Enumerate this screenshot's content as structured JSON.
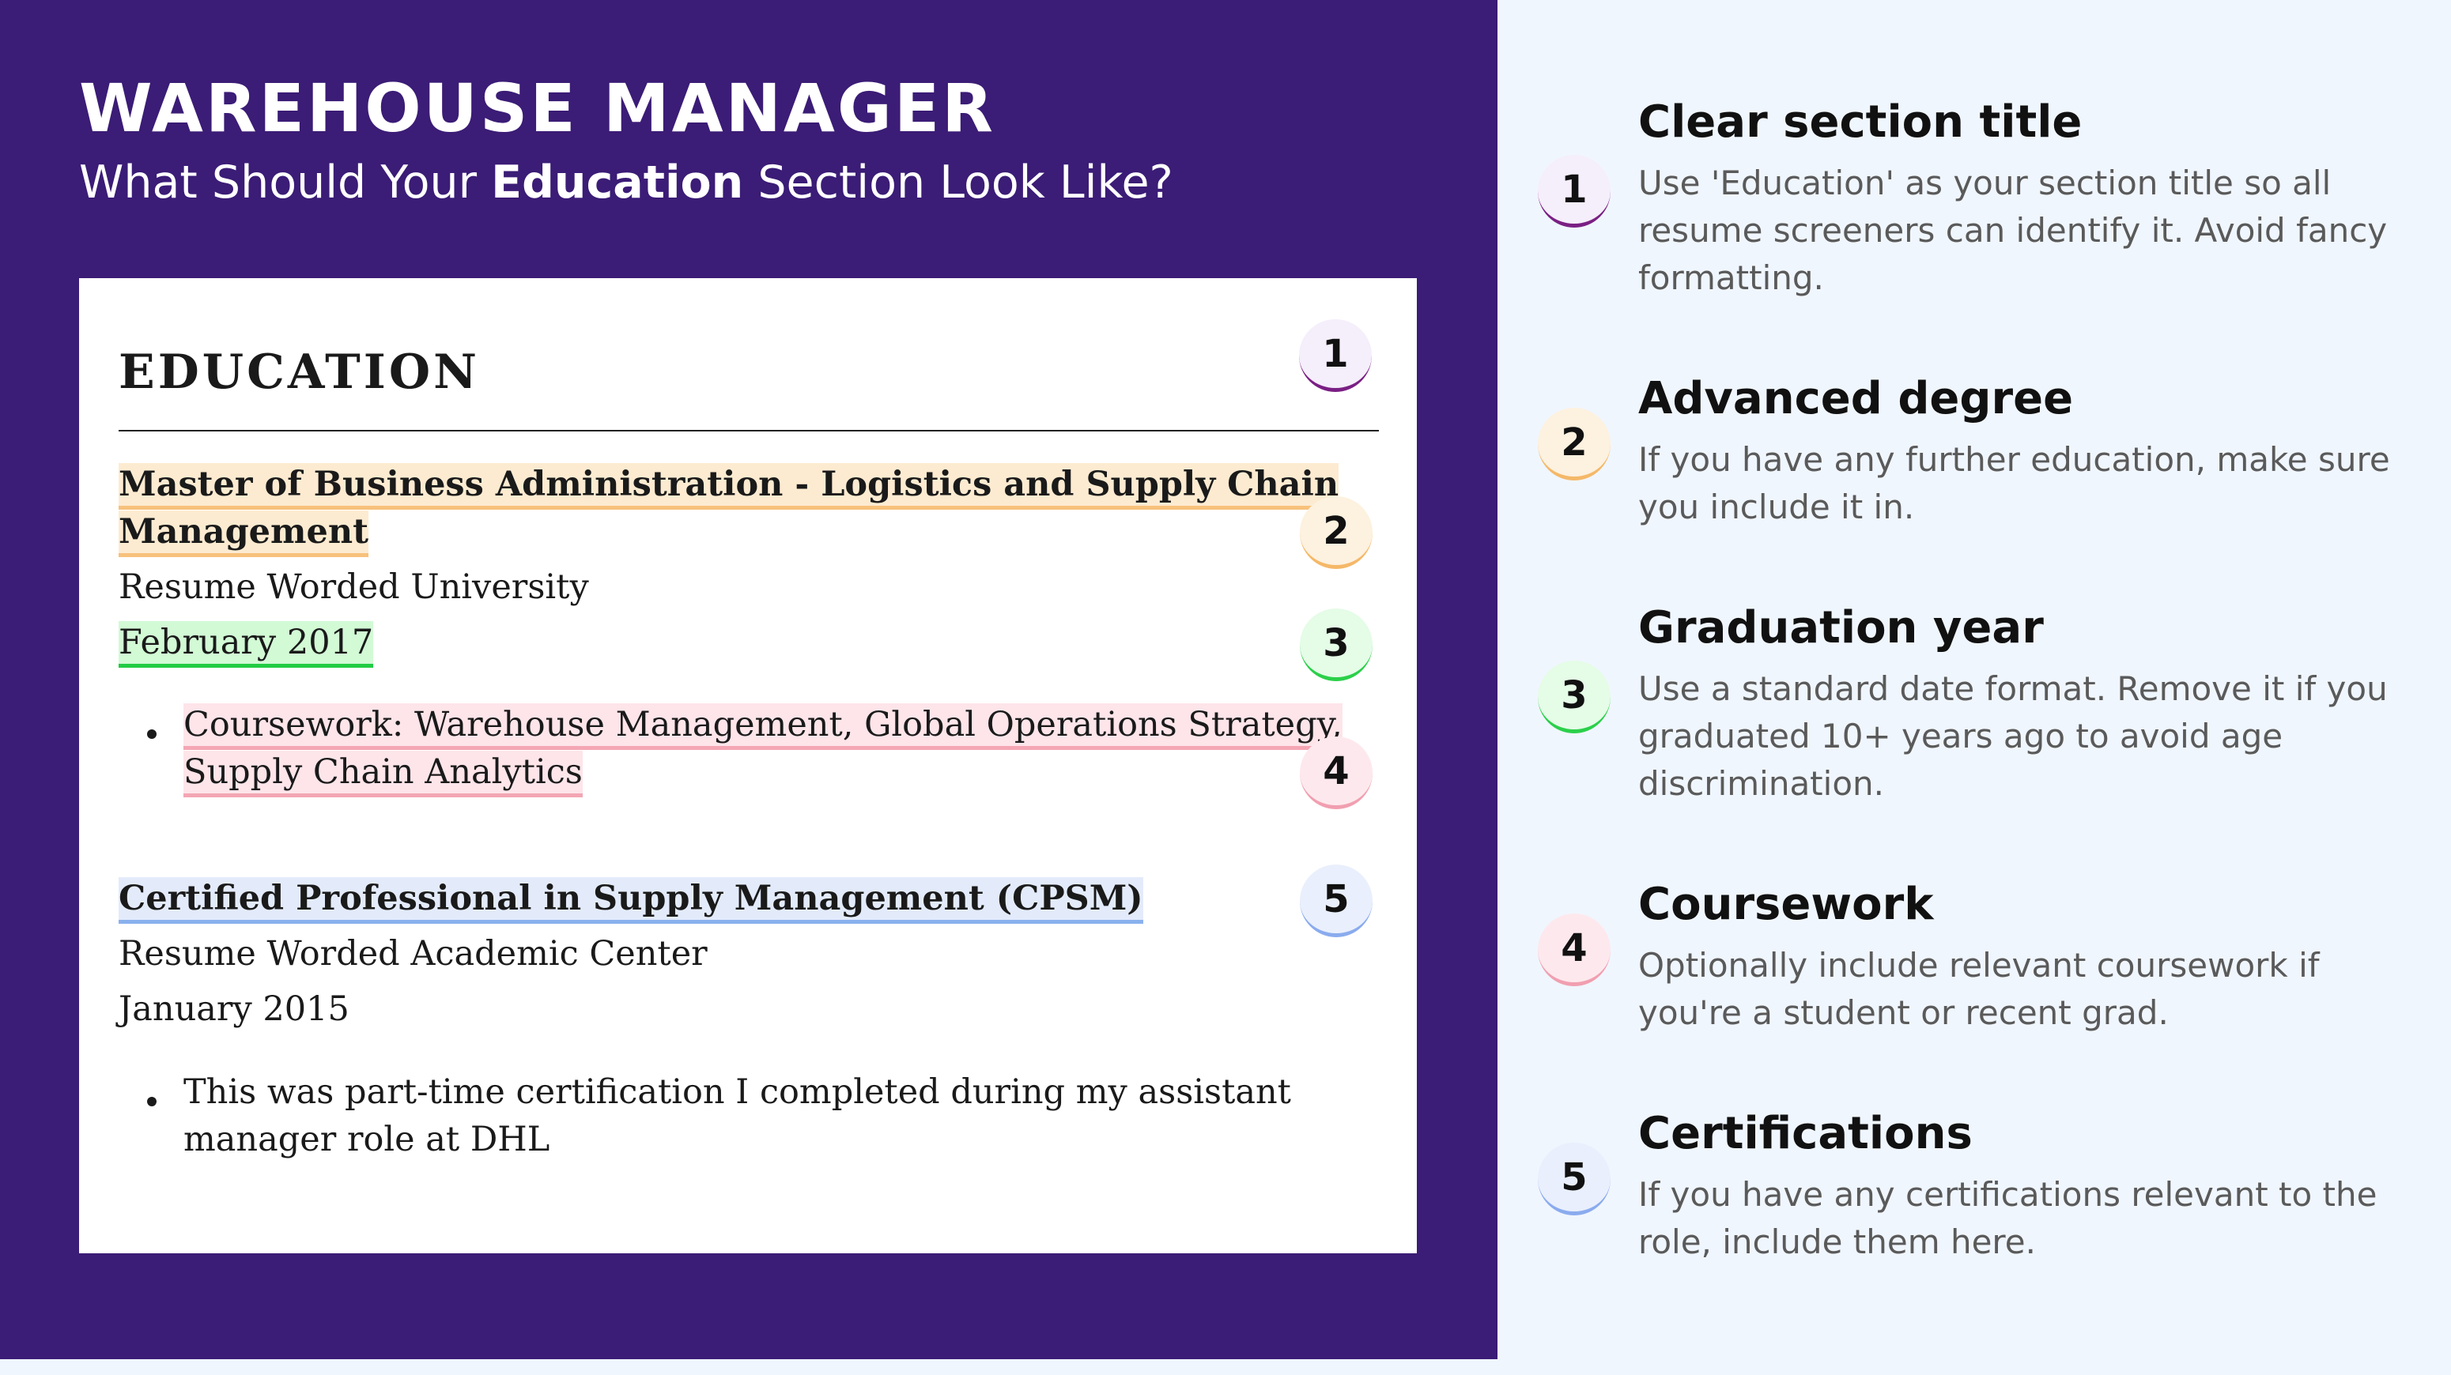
{
  "header": {
    "title": "WAREHOUSE MANAGER",
    "subtitle_pre": "What Should Your ",
    "subtitle_bold": "Education",
    "subtitle_post": " Section Look Like?"
  },
  "resume": {
    "heading": "EDUCATION",
    "entry1": {
      "degree_line1": "Master of Business Administration - Logistics and Supply Chain",
      "degree_line2": "Management",
      "school": "Resume Worded University",
      "date": "February 2017",
      "bullet_line1": "Coursework: Warehouse Management, Global Operations Strategy,",
      "bullet_line2": "Supply Chain Analytics"
    },
    "entry2": {
      "degree": "Certified Professional in Supply Management (CPSM)",
      "school": "Resume Worded Academic Center",
      "date": "January 2015",
      "bullet_line1": "This was part-time certification I completed during my assistant",
      "bullet_line2": "manager role at DHL"
    }
  },
  "badges": [
    "1",
    "2",
    "3",
    "4",
    "5"
  ],
  "tips": [
    {
      "number": "1",
      "title": "Clear section title",
      "text": "Use 'Education' as your section title so all resume screeners can identify it. Avoid fancy formatting."
    },
    {
      "number": "2",
      "title": "Advanced degree",
      "text": "If you have any further education, make sure you include it in."
    },
    {
      "number": "3",
      "title": "Graduation year",
      "text": "Use a standard date format. Remove it if you graduated 10+ years ago to avoid age discrimination."
    },
    {
      "number": "4",
      "title": "Coursework",
      "text": "Optionally include relevant coursework if you're a student or recent grad."
    },
    {
      "number": "5",
      "title": "Certifications",
      "text": "If you have any certifications relevant to the role, include them here."
    }
  ],
  "colors": {
    "background": "#3b1c76",
    "panel": "#f0f6fe",
    "purple": "#7a1f84",
    "orange": "#f7c17b",
    "green": "#22cc44",
    "pink": "#f4a6b4",
    "blue": "#8ab1ee"
  }
}
